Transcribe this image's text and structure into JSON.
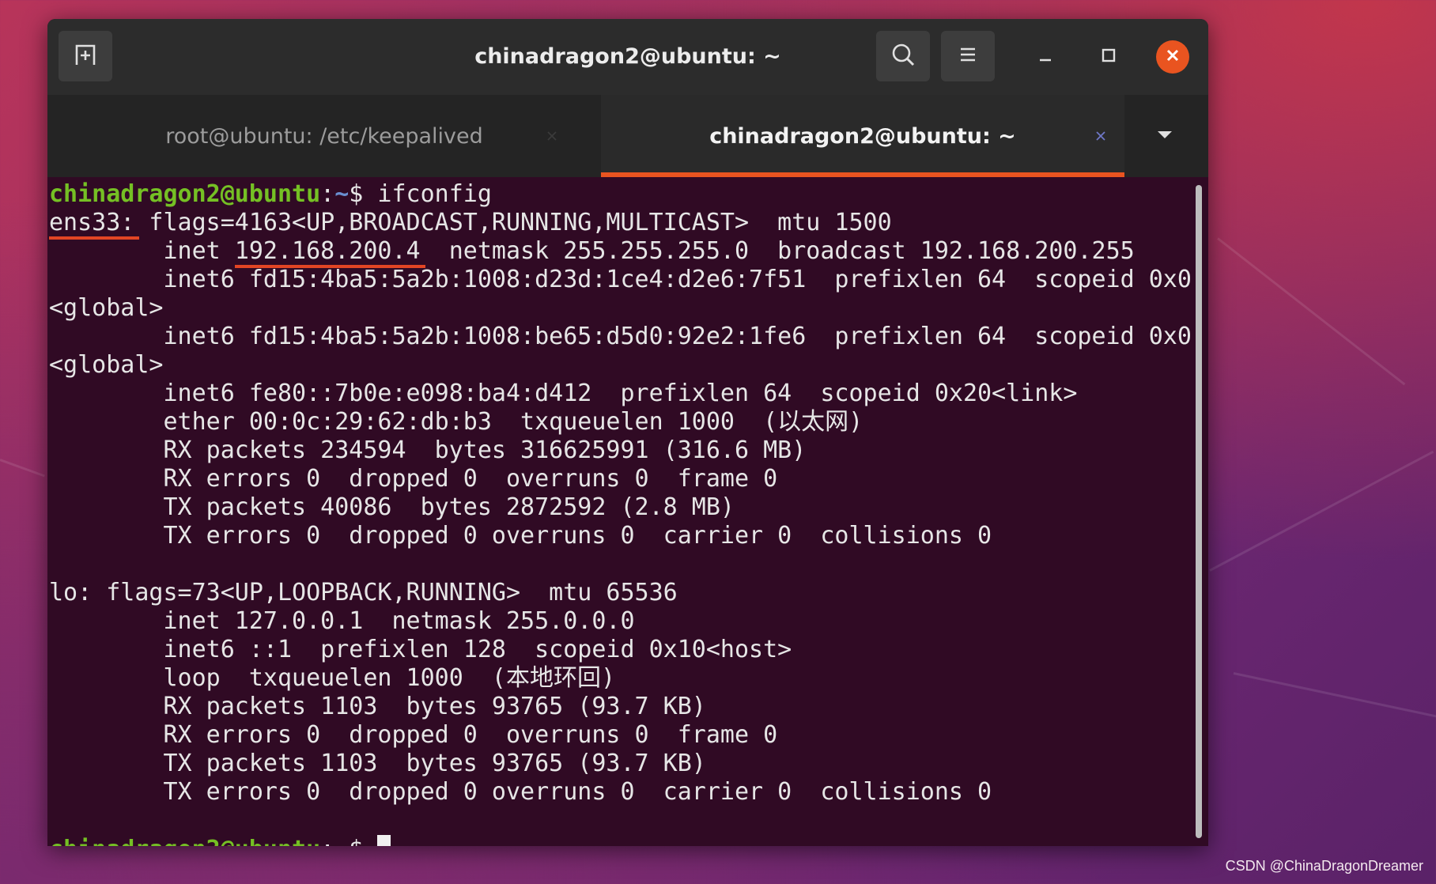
{
  "window": {
    "title": "chinadragon2@ubuntu: ~"
  },
  "tabs": [
    {
      "label": "root@ubuntu: /etc/keepalived",
      "active": false
    },
    {
      "label": "chinadragon2@ubuntu: ~",
      "active": true
    }
  ],
  "icons": {
    "new_tab": "new-tab-icon",
    "search": "search-icon",
    "menu": "hamburger-menu-icon",
    "minimize": "minimize-icon",
    "maximize": "maximize-icon",
    "close": "close-icon",
    "tab_close": "close-icon",
    "tab_list": "chevron-down-icon"
  },
  "colors": {
    "accent": "#e95420",
    "terminal_bg": "#300a24",
    "prompt_user": "#75c024",
    "prompt_dir": "#6a8fd0",
    "annotation": "#e24524"
  },
  "terminal": {
    "prompt": {
      "user": "chinadragon2@ubuntu",
      "sep": ":",
      "dir": "~",
      "sym": "$ "
    },
    "command": "ifconfig",
    "ens33": {
      "iface": "ens33:",
      "flags": " flags=4163<UP,BROADCAST,RUNNING,MULTICAST>  mtu 1500",
      "inet_pre": "        inet ",
      "inet_ip": "192.168.200.4",
      "inet_post": "  netmask 255.255.255.0  broadcast 192.168.200.255",
      "inet6_1": "        inet6 fd15:4ba5:5a2b:1008:d23d:1ce4:d2e6:7f51  prefixlen 64  scopeid 0x0",
      "inet6_1_wrap": "<global>",
      "inet6_2": "        inet6 fd15:4ba5:5a2b:1008:be65:d5d0:92e2:1fe6  prefixlen 64  scopeid 0x0",
      "inet6_2_wrap": "<global>",
      "inet6_3": "        inet6 fe80::7b0e:e098:ba4:d412  prefixlen 64  scopeid 0x20<link>",
      "ether": "        ether 00:0c:29:62:db:b3  txqueuelen 1000  (以太网)",
      "rx_packets": "        RX packets 234594  bytes 316625991 (316.6 MB)",
      "rx_errors": "        RX errors 0  dropped 0  overruns 0  frame 0",
      "tx_packets": "        TX packets 40086  bytes 2872592 (2.8 MB)",
      "tx_errors": "        TX errors 0  dropped 0 overruns 0  carrier 0  collisions 0"
    },
    "lo": {
      "flags": "lo: flags=73<UP,LOOPBACK,RUNNING>  mtu 65536",
      "inet": "        inet 127.0.0.1  netmask 255.0.0.0",
      "inet6": "        inet6 ::1  prefixlen 128  scopeid 0x10<host>",
      "loop": "        loop  txqueuelen 1000  (本地环回)",
      "rx_packets": "        RX packets 1103  bytes 93765 (93.7 KB)",
      "rx_errors": "        RX errors 0  dropped 0  overruns 0  frame 0",
      "tx_packets": "        TX packets 1103  bytes 93765 (93.7 KB)",
      "tx_errors": "        TX errors 0  dropped 0 overruns 0  carrier 0  collisions 0"
    }
  },
  "watermark": "CSDN @ChinaDragonDreamer"
}
